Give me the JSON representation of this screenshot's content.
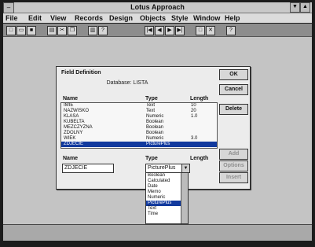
{
  "window": {
    "title": "Lotus Approach"
  },
  "menu": [
    "File",
    "Edit",
    "View",
    "Records",
    "Design",
    "Objects",
    "Style",
    "Window",
    "Help"
  ],
  "toolbar_icons": [
    "new-icon",
    "open-icon",
    "save-icon",
    "print-icon",
    "cut-icon",
    "copy-icon",
    "paste-icon",
    "find-icon",
    "first-icon",
    "prev-icon",
    "next-icon",
    "last-icon",
    "new-record-icon",
    "delete-icon",
    "help-icon"
  ],
  "dialog": {
    "title": "Field Definition",
    "database": "Database: LISTA",
    "headers": {
      "name": "Name",
      "type": "Type",
      "length": "Length"
    },
    "rows": [
      {
        "name": "IMIE",
        "type": "Text",
        "length": "10"
      },
      {
        "name": "NAZWISKO",
        "type": "Text",
        "length": "20"
      },
      {
        "name": "KLASA",
        "type": "Numeric",
        "length": "1.0"
      },
      {
        "name": "KUBELTA",
        "type": "Boolean",
        "length": ""
      },
      {
        "name": "MEZCZYZNA",
        "type": "Boolean",
        "length": ""
      },
      {
        "name": "ZDOLNY",
        "type": "Boolean",
        "length": ""
      },
      {
        "name": "WIEK",
        "type": "Numeric",
        "length": "3.0"
      },
      {
        "name": "ZDJECIE",
        "type": "PicturePlus",
        "length": ""
      }
    ],
    "selected_row": 7,
    "bottom_labels": {
      "name": "Name",
      "type": "Type",
      "length": "Length"
    },
    "name_value": "ZDJECIE",
    "type_value": "PicturePlus",
    "type_options": [
      "Boolean",
      "Calculated",
      "Date",
      "Memo",
      "Numeric",
      "PicturePlus",
      "Text",
      "Time"
    ],
    "selected_option": 5,
    "buttons": {
      "ok": "OK",
      "cancel": "Cancel",
      "delete": "Delete",
      "add": "Add",
      "options": "Options",
      "insert": "Insert"
    }
  }
}
